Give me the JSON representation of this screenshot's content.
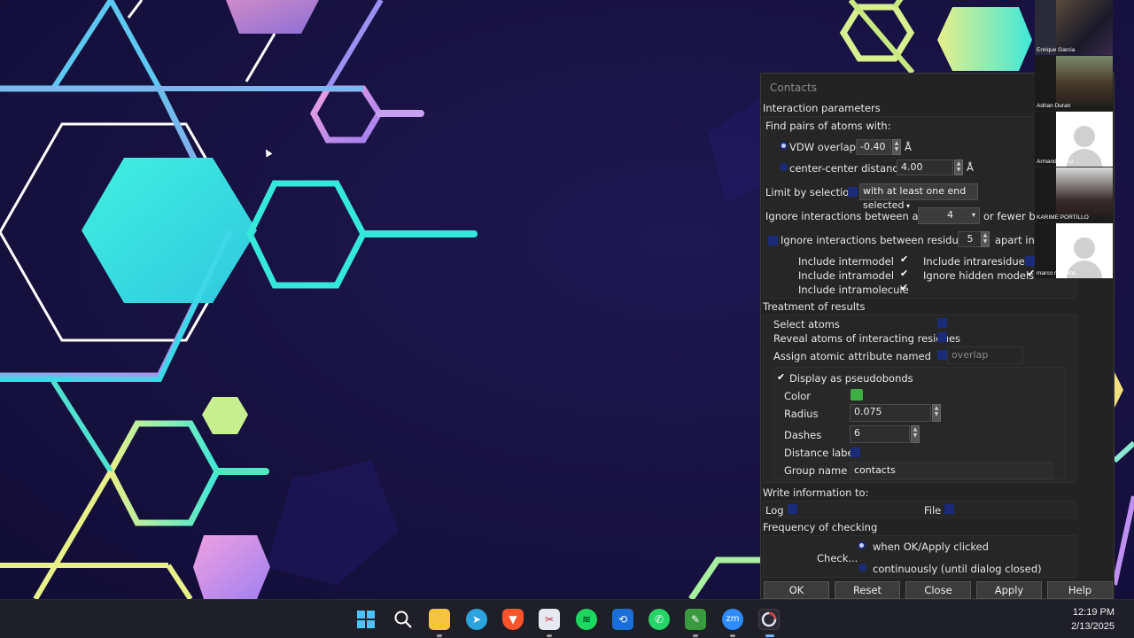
{
  "dialog": {
    "title": "Contacts",
    "interaction_parameters_label": "Interaction parameters",
    "find_pairs_label": "Find pairs of atoms with:",
    "vdw_label": "VDW overlap ≥",
    "vdw_value": "-0.40",
    "vdw_unit": "Å",
    "vdw_selected": true,
    "center_label": "center-center distance ≤",
    "center_value": "4.00",
    "center_unit": "Å",
    "limit_label": "Limit by selection",
    "limit_value": "with at least one end selected",
    "ignore_atoms_label": "Ignore interactions between atoms",
    "ignore_atoms_value": "4",
    "ignore_atoms_suffix": "or fewer bo",
    "ignore_residues_label": "Ignore interactions between residues <",
    "ignore_residues_value": "5",
    "ignore_residues_suffix": "apart in s",
    "include_intermodel": "Include intermodel",
    "include_intramodel": "Include intramodel",
    "include_intramolecule": "Include intramolecule",
    "include_intraresidue": "Include intraresidue",
    "ignore_hidden_models": "Ignore hidden models",
    "treatment_label": "Treatment of results",
    "select_atoms": "Select atoms",
    "reveal_atoms": "Reveal atoms of interacting residues",
    "assign_attr": "Assign atomic attribute named",
    "attr_name": "overlap",
    "display_pseudobonds": "Display as pseudobonds",
    "color_label": "Color",
    "pseudobond_color": "#3cb043",
    "radius_label": "Radius",
    "radius_value": "0.075",
    "dashes_label": "Dashes",
    "dashes_value": "6",
    "distance_label": "Distance label",
    "group_name_label": "Group name",
    "group_name_value": "contacts",
    "write_info_label": "Write information to:",
    "log_label": "Log",
    "file_label": "File",
    "frequency_label": "Frequency of checking",
    "check_label": "Check...",
    "when_ok": "when OK/Apply clicked",
    "continuously": "continuously (until dialog closed)"
  },
  "buttons": {
    "ok": "OK",
    "reset": "Reset",
    "close": "Close",
    "apply": "Apply",
    "help": "Help"
  },
  "participants": [
    {
      "name": "Enrique Garcia"
    },
    {
      "name": "Adrian Duran"
    },
    {
      "name": "Armando Cruz"
    },
    {
      "name": "KARIME PORTILLO"
    },
    {
      "name": "marco riquelme"
    }
  ],
  "taskbar": {
    "time": "12:19 PM",
    "date": "2/13/2025",
    "icons": [
      "windows-start-icon",
      "search-icon",
      "file-explorer-icon",
      "telegram-icon",
      "brave-icon",
      "snipping-tool-icon",
      "spotify-icon",
      "app-icon",
      "whatsapp-icon",
      "notepad-icon",
      "zoom-icon",
      "chimerax-icon"
    ]
  },
  "colors": {
    "accent_blue": "#1c2a7a",
    "desktop_bg": "#17113f"
  }
}
